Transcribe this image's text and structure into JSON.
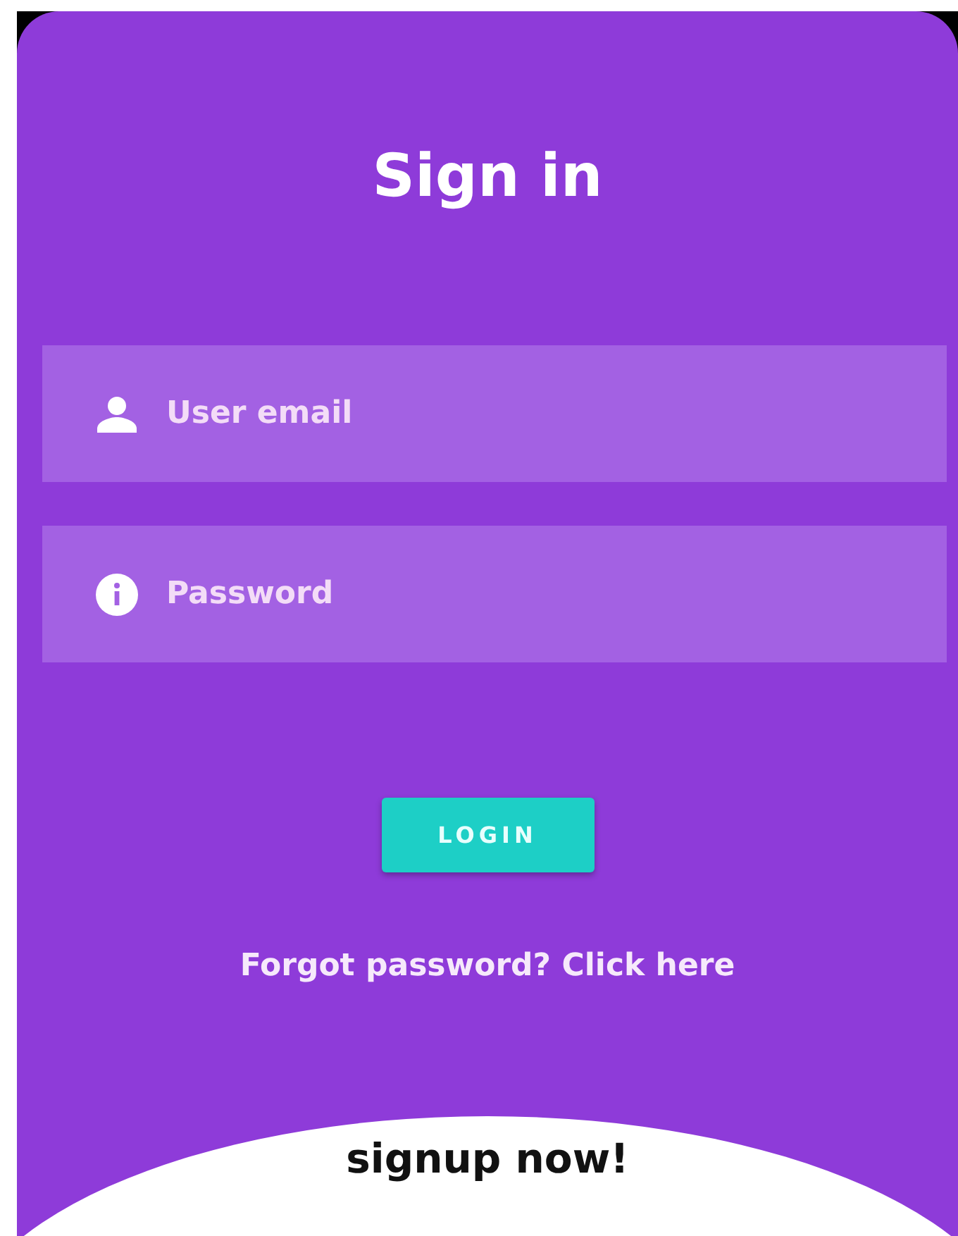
{
  "title": "Sign in",
  "fields": [
    {
      "kind": "user",
      "placeholder": "User email"
    },
    {
      "kind": "info",
      "placeholder": "Password"
    }
  ],
  "login_button": "LOGIN",
  "forgot_link": "Forgot password? Click here",
  "signup_link": "signup now!"
}
